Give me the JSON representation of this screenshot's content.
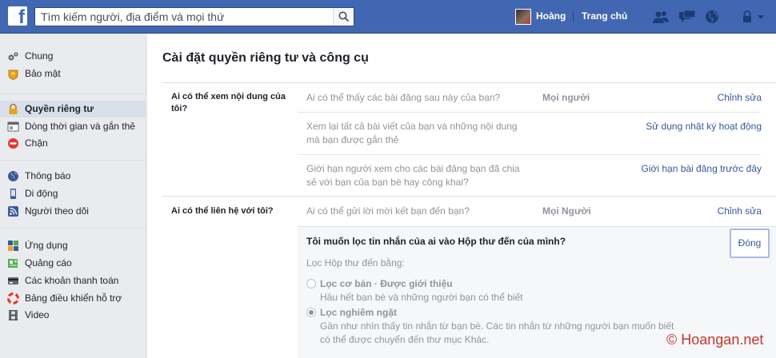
{
  "header": {
    "logo": "f",
    "search_placeholder": "Tìm kiếm người, địa điểm và mọi thứ",
    "user_name": "Hoàng",
    "home_label": "Trang chủ",
    "brand_color": "#4267b2",
    "icons": [
      "search-icon",
      "friend-requests-icon",
      "messages-icon",
      "notifications-globe-icon",
      "privacy-lock-icon",
      "dropdown-arrow-icon"
    ]
  },
  "sidebar": {
    "items": [
      {
        "label": "Chung",
        "icon": "gears-icon"
      },
      {
        "label": "Bảo mật",
        "icon": "security-badge-icon"
      },
      {
        "label": "Quyền riêng tư",
        "icon": "lock-icon",
        "active": true
      },
      {
        "label": "Dòng thời gian và gắn thẻ",
        "icon": "timeline-icon"
      },
      {
        "label": "Chặn",
        "icon": "block-icon"
      },
      {
        "label": "Thông báo",
        "icon": "globe-icon"
      },
      {
        "label": "Di động",
        "icon": "mobile-icon"
      },
      {
        "label": "Người theo dõi",
        "icon": "rss-icon"
      },
      {
        "label": "Ứng dụng",
        "icon": "apps-icon"
      },
      {
        "label": "Quảng cáo",
        "icon": "ads-icon"
      },
      {
        "label": "Các khoản thanh toán",
        "icon": "payment-card-icon"
      },
      {
        "label": "Bảng điều khiển hỗ trợ",
        "icon": "support-lifebuoy-icon"
      },
      {
        "label": "Video",
        "icon": "film-icon"
      }
    ]
  },
  "main": {
    "title": "Cài đặt quyền riêng tư và công cụ",
    "sections": [
      {
        "label": "Ai có thể xem nội dung của tôi?",
        "rows": [
          {
            "question": "Ai có thể thấy các bài đăng sau này của bạn?",
            "value": "Mọi người",
            "action": "Chỉnh sửa"
          },
          {
            "question": "Xem lại tất cả bài viết của bạn và những nội dung mà bạn được gắn thẻ",
            "value": "",
            "action": "Sử dụng nhật ký hoạt động"
          },
          {
            "question": "Giới hạn người xem cho các bài đăng bạn đã chia sẻ với bạn của bạn bè hay công khai?",
            "value": "",
            "action": "Giới hạn bài đăng trước đây"
          }
        ]
      },
      {
        "label": "Ai có thể liên hệ với tôi?",
        "rows": [
          {
            "question": "Ai có thể gửi lời mời kết bạn đến bạn?",
            "value": "Mọi Người",
            "action": "Chỉnh sửa"
          }
        ]
      }
    ],
    "expanded": {
      "title": "Tôi muốn lọc tin nhắn của ai vào Hộp thư đến của mình?",
      "close_label": "Đóng",
      "subtitle": "Lọc Hộp thư đến bằng:",
      "options": [
        {
          "label": "Lọc cơ bản · Được giới thiệu",
          "desc": "Hầu hết bạn bè và những người bạn có thể biết",
          "checked": false
        },
        {
          "label": "Lọc nghiêm ngặt",
          "desc": "Gần như nhìn thấy tin nhắn từ bạn bè. Các tin nhắn từ những người bạn muốn biết có thể được chuyển đến thư mục Khác.",
          "checked": true
        }
      ]
    }
  },
  "watermark": "© Hoangan.net"
}
